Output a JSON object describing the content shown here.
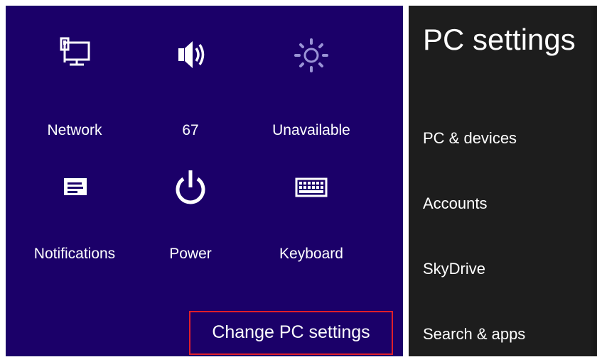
{
  "charms": {
    "tiles": [
      {
        "label": "Network",
        "icon": "network-icon"
      },
      {
        "label": "67",
        "icon": "volume-icon"
      },
      {
        "label": "Unavailable",
        "icon": "brightness-icon"
      },
      {
        "label": "Notifications",
        "icon": "notifications-icon"
      },
      {
        "label": "Power",
        "icon": "power-icon"
      },
      {
        "label": "Keyboard",
        "icon": "keyboard-icon"
      }
    ],
    "change_settings_label": "Change PC settings",
    "panel_color": "#1b0069",
    "highlight_color": "#e01e2a"
  },
  "pc_settings": {
    "title": "PC settings",
    "items": [
      {
        "label": "PC & devices"
      },
      {
        "label": "Accounts"
      },
      {
        "label": "SkyDrive"
      },
      {
        "label": "Search & apps"
      }
    ],
    "panel_color": "#1d1d1d"
  }
}
